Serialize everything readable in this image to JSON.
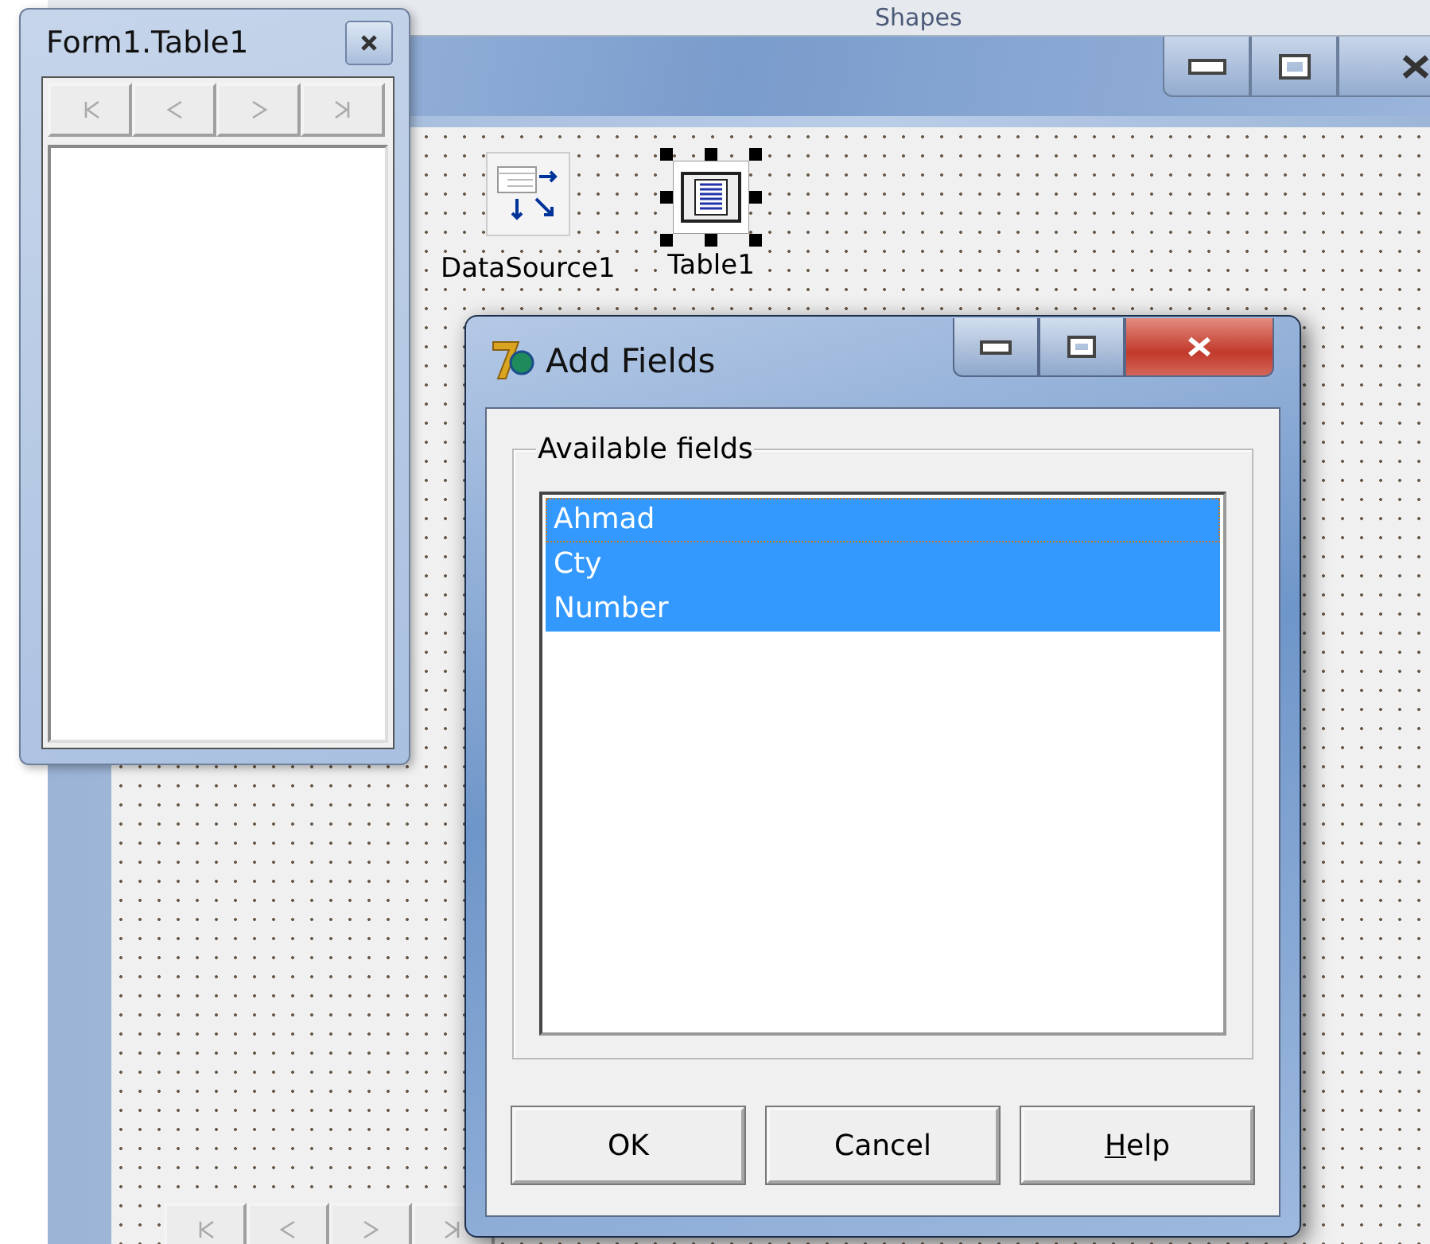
{
  "designer": {
    "toolbar_tab": "Shapes",
    "components": [
      {
        "kind": "datasource",
        "label": "DataSource1",
        "selected": false
      },
      {
        "kind": "table",
        "label": "Table1",
        "selected": true
      }
    ],
    "bottom_navigator": [
      {
        "kind": "first",
        "disabled": true
      },
      {
        "kind": "prev",
        "disabled": true
      },
      {
        "kind": "next",
        "disabled": true
      },
      {
        "kind": "last",
        "disabled": true
      }
    ]
  },
  "field_window": {
    "title": "Form1.Table1",
    "navigator": [
      {
        "kind": "first",
        "disabled": true
      },
      {
        "kind": "prev",
        "disabled": true
      },
      {
        "kind": "next",
        "disabled": true
      },
      {
        "kind": "last",
        "disabled": true
      }
    ]
  },
  "dialog": {
    "title": "Add Fields",
    "group_label": "Available fields",
    "fields": [
      {
        "name": "Ahmad",
        "selected": true,
        "focused": true
      },
      {
        "name": "Cty",
        "selected": true,
        "focused": false
      },
      {
        "name": "Number",
        "selected": true,
        "focused": false
      }
    ],
    "buttons": [
      {
        "label": "OK",
        "underline_first": false
      },
      {
        "label": "Cancel",
        "underline_first": false
      },
      {
        "label": "Help",
        "underline_first": true
      }
    ]
  }
}
